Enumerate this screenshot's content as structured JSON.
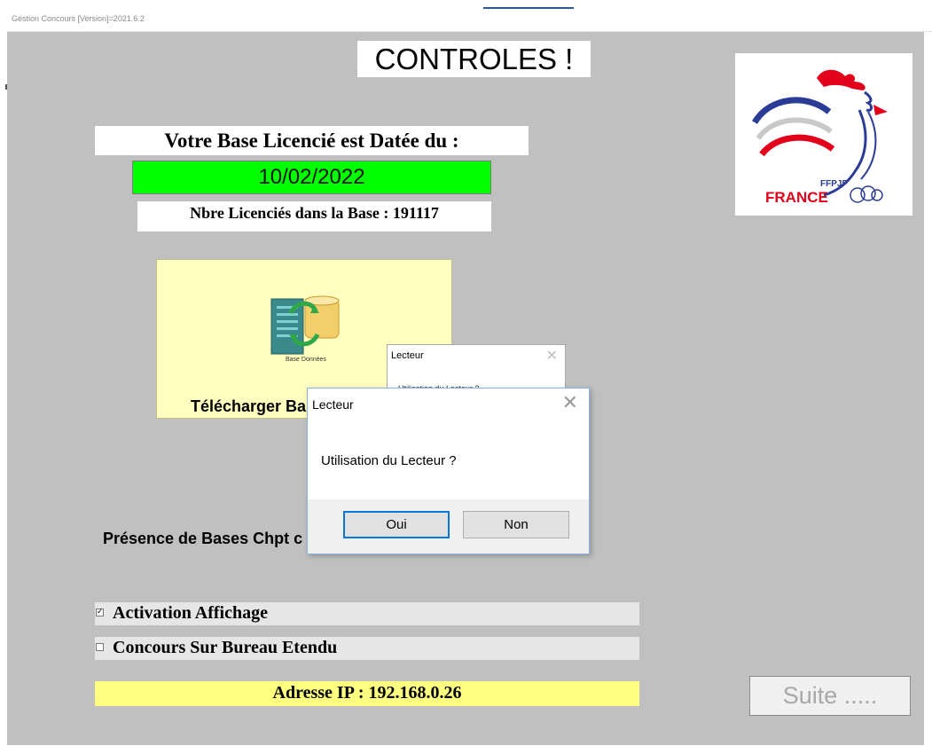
{
  "window": {
    "title": "Gestion Concours [Version]=2021.6.2"
  },
  "main": {
    "title": "CONTROLES !",
    "base_label": "Votre Base Licencié est Datée du :",
    "base_date": "10/02/2022",
    "licencies_count_label": "Nbre Licenciés dans la Base : 191117",
    "download_button_label": "Télécharger Ba",
    "download_icon_caption": "Base  Données",
    "presence_label": "Présence de Bases Chpt c",
    "checkbox_activation": {
      "label": "Activation Affichage",
      "checked": true
    },
    "checkbox_bureau": {
      "label": "Concours Sur Bureau Etendu",
      "checked": false
    },
    "ip_label": "Adresse IP : 192.168.0.26",
    "suite_button_label": "Suite ....."
  },
  "logo": {
    "brand_small": "FFPJP",
    "brand_large": "FRANCE"
  },
  "dialog_back": {
    "title": "Lecteur",
    "message": "Utilisation du Lecteur ?"
  },
  "dialog": {
    "title": "Lecteur",
    "message": "Utilisation du Lecteur ?",
    "yes_label": "Oui",
    "no_label": "Non"
  },
  "colors": {
    "client_bg": "#c0c0c0",
    "date_bg": "#00ff00",
    "download_bg": "#ffffc0",
    "ip_bg": "#ffff80",
    "logo_red": "#e3001b",
    "logo_blue": "#2a3c96"
  }
}
